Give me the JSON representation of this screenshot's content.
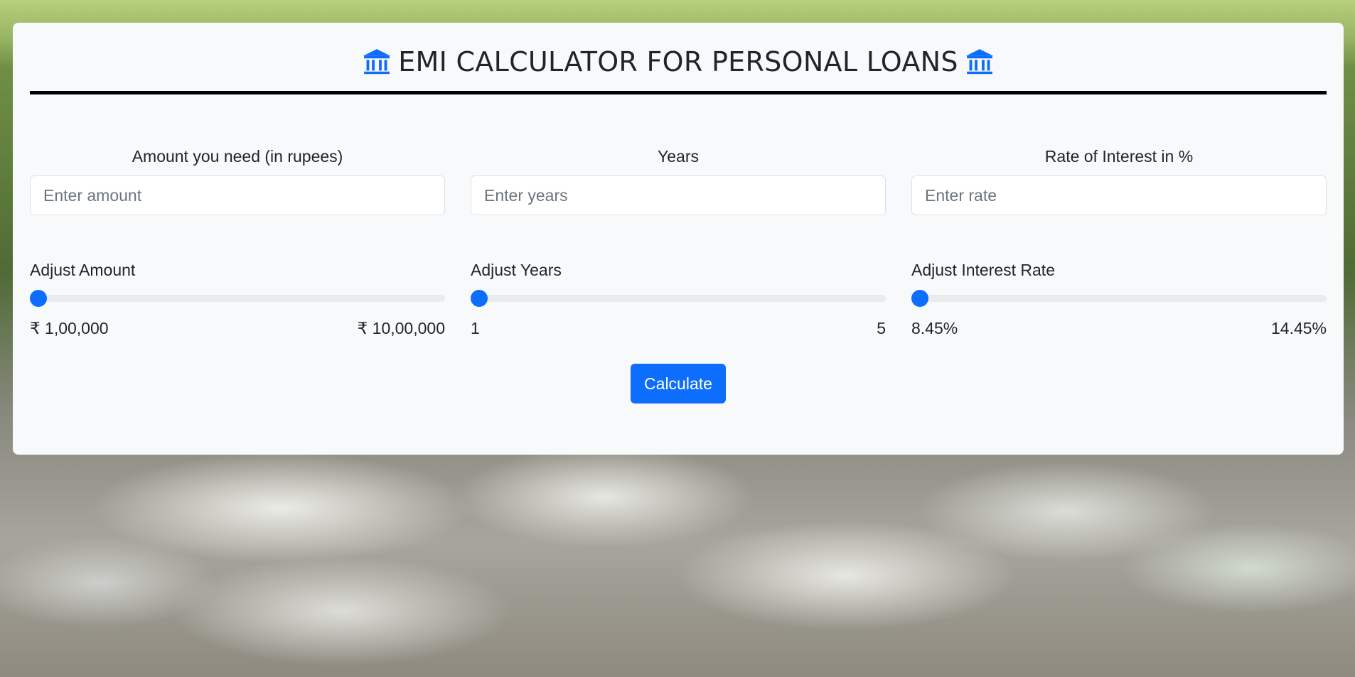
{
  "header": {
    "title": "EMI CALCULATOR FOR PERSONAL LOANS",
    "icon": "bank-icon",
    "icon_color": "#0d6efd"
  },
  "inputs": {
    "amount": {
      "label": "Amount you need (in rupees)",
      "placeholder": "Enter amount",
      "value": ""
    },
    "years": {
      "label": "Years",
      "placeholder": "Enter years",
      "value": ""
    },
    "rate": {
      "label": "Rate of Interest in %",
      "placeholder": "Enter rate",
      "value": ""
    }
  },
  "sliders": {
    "amount": {
      "label": "Adjust Amount",
      "min_label": "₹ 1,00,000",
      "max_label": "₹ 10,00,000",
      "level": 0
    },
    "years": {
      "label": "Adjust Years",
      "min_label": "1",
      "max_label": "5",
      "level": 0
    },
    "rate": {
      "label": "Adjust Interest Rate",
      "min_label": "8.45%",
      "max_label": "14.45%",
      "level": 0
    }
  },
  "actions": {
    "calculate_label": "Calculate"
  },
  "colors": {
    "accent": "#0d6efd",
    "card_bg": "#f8f9fa",
    "track": "#e9ecef"
  }
}
